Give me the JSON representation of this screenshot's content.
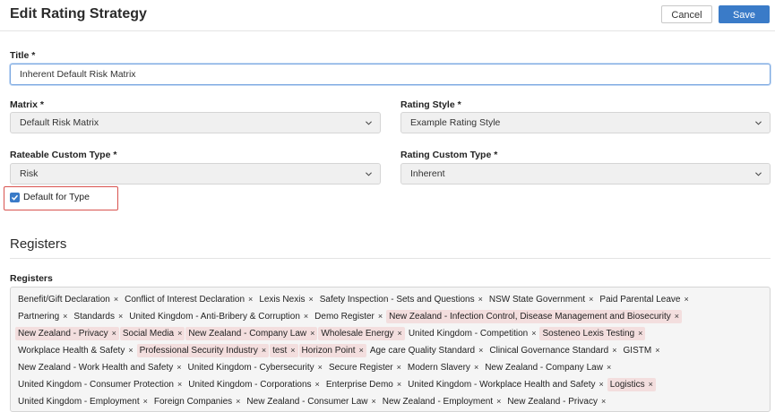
{
  "header": {
    "title": "Edit Rating Strategy",
    "cancel_label": "Cancel",
    "save_label": "Save"
  },
  "form": {
    "title_label": "Title *",
    "title_value": "Inherent Default Risk Matrix",
    "matrix_label": "Matrix *",
    "matrix_value": "Default Risk Matrix",
    "rating_style_label": "Rating Style *",
    "rating_style_value": "Example Rating Style",
    "rateable_type_label": "Rateable Custom Type *",
    "rateable_type_value": "Risk",
    "rating_type_label": "Rating Custom Type *",
    "rating_type_value": "Inherent",
    "default_checkbox_label": "Default for Type",
    "default_checked": true
  },
  "registers": {
    "section_title": "Registers",
    "field_label": "Registers",
    "rows": [
      [
        {
          "t": "Benefit/Gift Declaration"
        },
        {
          "t": "Conflict of Interest Declaration"
        },
        {
          "t": "Lexis Nexis"
        },
        {
          "t": "Safety Inspection - Sets and Questions"
        },
        {
          "t": "NSW State Government"
        },
        {
          "t": "Paid Parental Leave"
        }
      ],
      [
        {
          "t": "Partnering"
        },
        {
          "t": "Standards"
        },
        {
          "t": "United Kingdom - Anti-Bribery & Corruption"
        },
        {
          "t": "Demo Register"
        },
        {
          "t": "New Zealand - Infection Control, Disease Management and Biosecurity",
          "p": true
        }
      ],
      [
        {
          "t": "New Zealand - Privacy",
          "p": true
        },
        {
          "t": "Social Media",
          "p": true
        },
        {
          "t": "New Zealand - Company Law",
          "p": true
        },
        {
          "t": "Wholesale Energy",
          "p": true
        },
        {
          "t": "United Kingdom - Competition"
        },
        {
          "t": "Sosteneo Lexis Testing",
          "p": true
        }
      ],
      [
        {
          "t": "Workplace Health & Safety"
        },
        {
          "t": "Professional Security Industry",
          "p": true
        },
        {
          "t": "test",
          "p": true
        },
        {
          "t": "Horizon Point",
          "p": true
        },
        {
          "t": "Age care Quality Standard"
        },
        {
          "t": "Clinical Governance Standard"
        },
        {
          "t": "GISTM"
        }
      ],
      [
        {
          "t": "New Zealand - Work Health and Safety"
        },
        {
          "t": "United Kingdom - Cybersecurity"
        },
        {
          "t": "Secure Register"
        },
        {
          "t": "Modern Slavery"
        },
        {
          "t": "New Zealand - Company Law"
        }
      ],
      [
        {
          "t": "United Kingdom - Consumer Protection"
        },
        {
          "t": "United Kingdom - Corporations"
        },
        {
          "t": "Enterprise Demo"
        },
        {
          "t": "United Kingdom - Workplace Health and Safety"
        },
        {
          "t": "Logistics",
          "p": true
        }
      ],
      [
        {
          "t": "United Kingdom - Employment"
        },
        {
          "t": "Foreign Companies"
        },
        {
          "t": "New Zealand - Consumer Law"
        },
        {
          "t": "New Zealand - Employment"
        },
        {
          "t": "New Zealand - Privacy"
        }
      ]
    ],
    "remove_glyph": "×"
  }
}
